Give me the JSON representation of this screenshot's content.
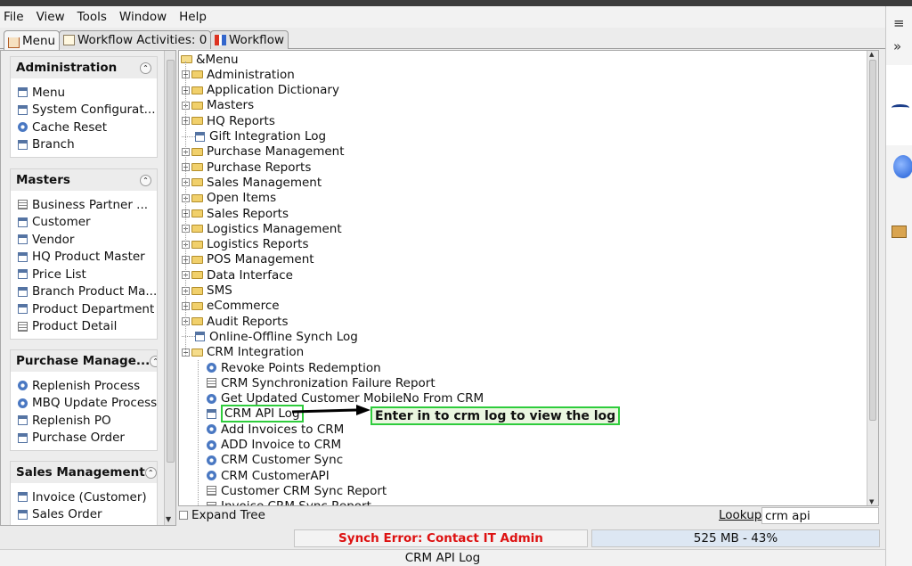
{
  "menubar": {
    "items": [
      "File",
      "View",
      "Tools",
      "Window",
      "Help"
    ]
  },
  "tabs": [
    {
      "label": "Menu",
      "icon": "home-icon"
    },
    {
      "label": "Workflow Activities: 0",
      "icon": "document-icon"
    },
    {
      "label": "Workflow",
      "icon": "workflow-icon"
    }
  ],
  "sidebar": {
    "groups": [
      {
        "title": "Administration",
        "items": [
          {
            "label": "Menu",
            "icon": "window-icon"
          },
          {
            "label": "System Configurat...",
            "icon": "window-icon"
          },
          {
            "label": "Cache Reset",
            "icon": "process-icon"
          },
          {
            "label": "Branch",
            "icon": "window-icon"
          }
        ]
      },
      {
        "title": "Masters",
        "items": [
          {
            "label": "Business Partner ...",
            "icon": "report-icon"
          },
          {
            "label": "Customer",
            "icon": "window-icon"
          },
          {
            "label": "Vendor",
            "icon": "window-icon"
          },
          {
            "label": "HQ Product Master",
            "icon": "window-icon"
          },
          {
            "label": "Price List",
            "icon": "window-icon"
          },
          {
            "label": "Branch Product Ma...",
            "icon": "window-icon"
          },
          {
            "label": "Product Department",
            "icon": "window-icon"
          },
          {
            "label": "Product Detail",
            "icon": "report-icon"
          }
        ]
      },
      {
        "title": "Purchase Manage...",
        "items": [
          {
            "label": "Replenish Process",
            "icon": "process-icon"
          },
          {
            "label": "MBQ Update Process",
            "icon": "process-icon"
          },
          {
            "label": "Replenish PO",
            "icon": "window-icon"
          },
          {
            "label": "Purchase Order",
            "icon": "window-icon"
          }
        ]
      },
      {
        "title": "Sales Management",
        "items": [
          {
            "label": "Invoice (Customer)",
            "icon": "window-icon"
          },
          {
            "label": "Sales Order",
            "icon": "window-icon"
          }
        ]
      }
    ]
  },
  "tree": {
    "root": "&Menu",
    "folders": [
      "Administration",
      "Application Dictionary",
      "Masters",
      "HQ Reports"
    ],
    "gift_log": "Gift Integration Log",
    "folders2": [
      "Purchase Management",
      "Purchase Reports",
      "Sales Management",
      "Open Items",
      "Sales Reports",
      "Logistics Management",
      "Logistics Reports",
      "POS Management",
      "Data Interface",
      "SMS",
      "eCommerce",
      "Audit Reports"
    ],
    "synch_log": "Online-Offline Synch Log",
    "crm_folder": "CRM Integration",
    "crm_children": [
      {
        "label": "Revoke Points Redemption",
        "icon": "process-icon"
      },
      {
        "label": "CRM Synchronization Failure Report",
        "icon": "report-icon"
      },
      {
        "label": "Get Updated Customer MobileNo From CRM",
        "icon": "process-icon"
      },
      {
        "label": "CRM API Log",
        "icon": "window-icon",
        "selected": true
      },
      {
        "label": "Add Invoices to CRM",
        "icon": "process-icon"
      },
      {
        "label": "ADD Invoice to CRM",
        "icon": "process-icon"
      },
      {
        "label": "CRM Customer Sync",
        "icon": "process-icon"
      },
      {
        "label": "CRM CustomerAPI",
        "icon": "process-icon"
      },
      {
        "label": "Customer CRM Sync Report",
        "icon": "report-icon"
      },
      {
        "label": "Invoice CRM Sync Report",
        "icon": "report-icon"
      }
    ]
  },
  "annotation": "Enter in to crm log to view the log",
  "bottom": {
    "expand_label": "Expand Tree",
    "lookup_label": "Lookup",
    "lookup_value": "crm api",
    "status_error": "Synch Error: Contact IT Admin",
    "memory": "525 MB - 43%",
    "footer": "CRM API Log"
  },
  "colors": {
    "highlight": "#2ecc3c",
    "error": "#dd1111"
  }
}
